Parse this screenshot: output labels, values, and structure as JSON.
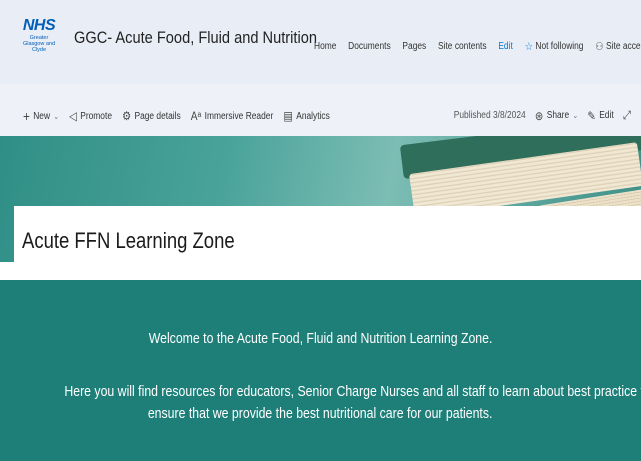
{
  "site": {
    "logo_text": "NHS",
    "logo_subtext": "Greater Glasgow and Clyde",
    "title": "GGC- Acute Food, Fluid and Nutrition"
  },
  "nav": {
    "items": [
      "Home",
      "Documents",
      "Pages",
      "Site contents"
    ],
    "edit": "Edit",
    "following": "Not following",
    "access": "Site access"
  },
  "commandbar": {
    "new": "New",
    "promote": "Promote",
    "page_details": "Page details",
    "immersive_reader": "Immersive Reader",
    "analytics": "Analytics",
    "published": "Published 3/8/2024",
    "share": "Share",
    "edit": "Edit"
  },
  "page": {
    "title": "Acute FFN Learning Zone",
    "welcome": "Welcome to the Acute Food, Fluid and Nutrition Learning Zone.",
    "intro_line1": "Here you will find resources for educators, Senior Charge Nurses and all staff to learn about best practice to",
    "intro_line2": "ensure that we provide the best nutritional care for our patients."
  },
  "colors": {
    "band": "#1e7f79",
    "link": "#0078d4",
    "nhs_blue": "#005eb8"
  },
  "icons": {
    "follow": "star-outline-icon",
    "access": "people-icon",
    "new": "plus-icon",
    "promote": "megaphone-icon",
    "page_details": "gear-icon",
    "immersive_reader": "reader-icon",
    "analytics": "chart-icon",
    "share": "share-icon",
    "edit": "pencil-icon"
  }
}
